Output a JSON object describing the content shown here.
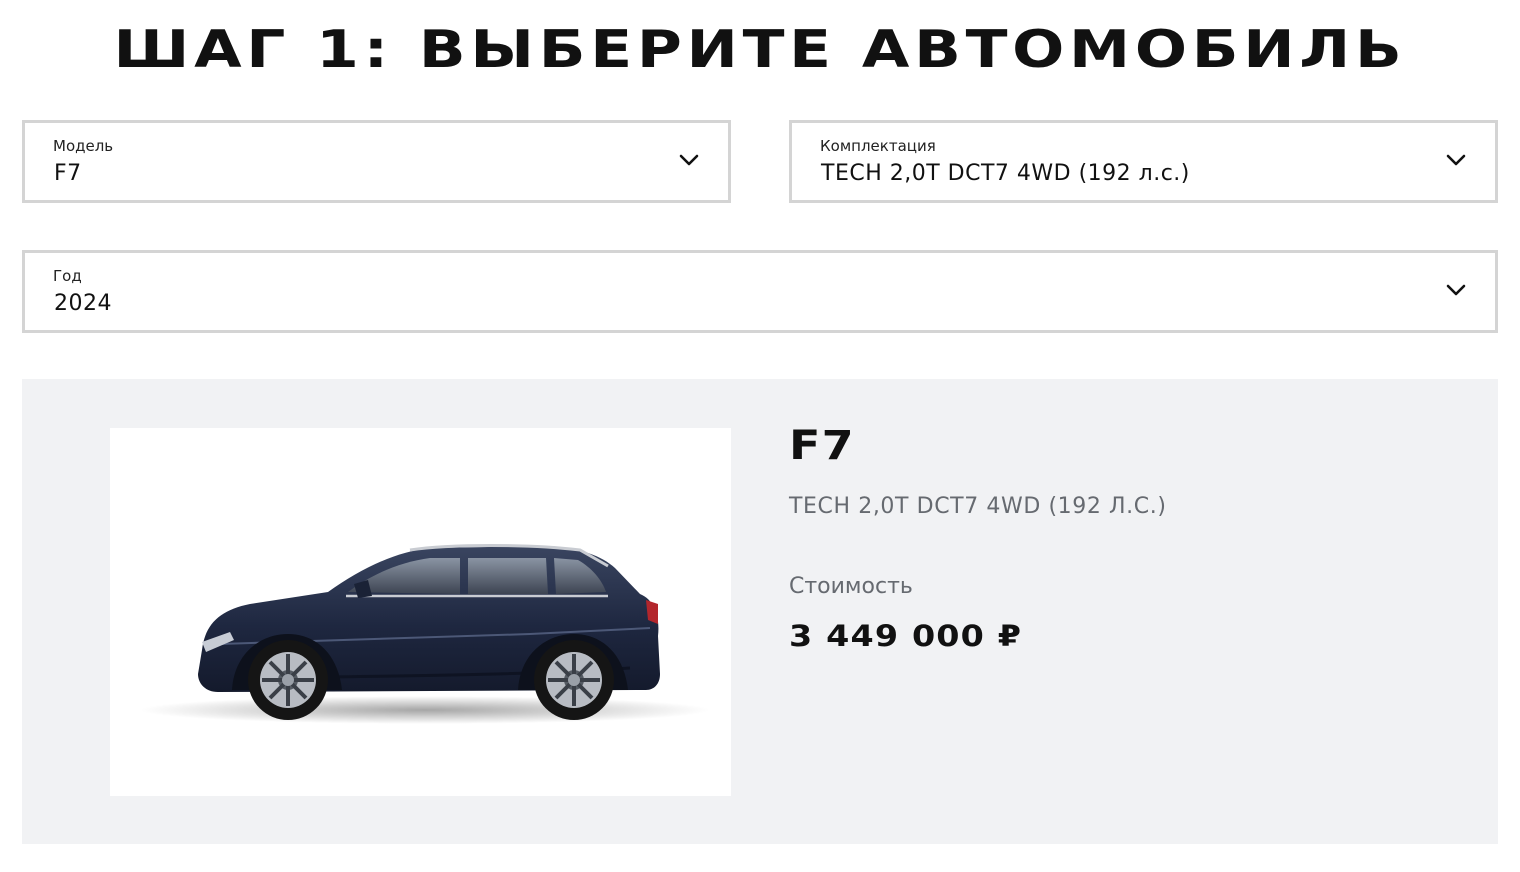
{
  "page": {
    "title": "ШАГ 1: ВЫБЕРИТЕ АВТОМОБИЛЬ"
  },
  "selects": {
    "model": {
      "label": "Модель",
      "value": "F7"
    },
    "trim": {
      "label": "Комплектация",
      "value": "TECH 2,0T DCT7 4WD (192 л.с.)"
    },
    "year": {
      "label": "Год",
      "value": "2024"
    }
  },
  "summary": {
    "model": "F7",
    "trim": "TECH 2,0T DCT7 4WD (192 Л.С.)",
    "price_label": "Стоимость",
    "price": "3 449 000 ₽",
    "image_alt": "dark blue SUV side view"
  },
  "colors": {
    "border": "#d4d4d4",
    "card_bg": "#f1f2f4",
    "muted_text": "#666a70",
    "car_body": "#1f2a44"
  }
}
